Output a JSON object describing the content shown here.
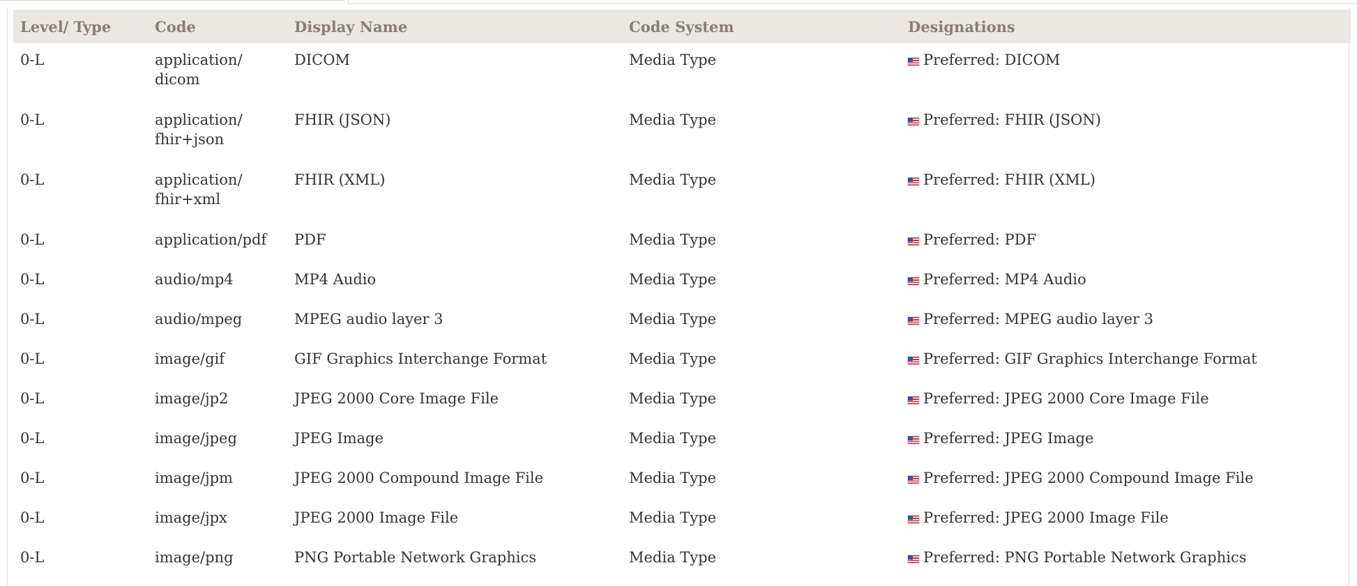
{
  "table": {
    "headers": [
      "Level/ Type",
      "Code",
      "Display Name",
      "Code System",
      "Designations"
    ],
    "rows": [
      {
        "level": "0-L",
        "code_line1": "application/",
        "code_line2": "dicom",
        "display": "DICOM",
        "system": "Media Type",
        "designation": "Preferred: DICOM"
      },
      {
        "level": "0-L",
        "code_line1": "application/",
        "code_line2": "fhir+json",
        "display": "FHIR (JSON)",
        "system": "Media Type",
        "designation": "Preferred: FHIR (JSON)"
      },
      {
        "level": "0-L",
        "code_line1": "application/",
        "code_line2": "fhir+xml",
        "display": "FHIR (XML)",
        "system": "Media Type",
        "designation": "Preferred: FHIR (XML)"
      },
      {
        "level": "0-L",
        "code_line1": "application/pdf",
        "code_line2": "",
        "display": "PDF",
        "system": "Media Type",
        "designation": "Preferred: PDF"
      },
      {
        "level": "0-L",
        "code_line1": "audio/mp4",
        "code_line2": "",
        "display": "MP4 Audio",
        "system": "Media Type",
        "designation": "Preferred: MP4 Audio"
      },
      {
        "level": "0-L",
        "code_line1": "audio/mpeg",
        "code_line2": "",
        "display": "MPEG audio layer 3",
        "system": "Media Type",
        "designation": "Preferred: MPEG audio layer 3"
      },
      {
        "level": "0-L",
        "code_line1": "image/gif",
        "code_line2": "",
        "display": "GIF Graphics Interchange Format",
        "system": "Media Type",
        "designation": "Preferred: GIF Graphics Interchange Format"
      },
      {
        "level": "0-L",
        "code_line1": "image/jp2",
        "code_line2": "",
        "display": "JPEG 2000 Core Image File",
        "system": "Media Type",
        "designation": "Preferred: JPEG 2000 Core Image File"
      },
      {
        "level": "0-L",
        "code_line1": "image/jpeg",
        "code_line2": "",
        "display": "JPEG Image",
        "system": "Media Type",
        "designation": "Preferred: JPEG Image"
      },
      {
        "level": "0-L",
        "code_line1": "image/jpm",
        "code_line2": "",
        "display": "JPEG 2000 Compound Image File",
        "system": "Media Type",
        "designation": "Preferred: JPEG 2000 Compound Image File"
      },
      {
        "level": "0-L",
        "code_line1": "image/jpx",
        "code_line2": "",
        "display": "JPEG 2000 Image File",
        "system": "Media Type",
        "designation": "Preferred: JPEG 2000 Image File"
      },
      {
        "level": "0-L",
        "code_line1": "image/png",
        "code_line2": "",
        "display": "PNG Portable Network Graphics",
        "system": "Media Type",
        "designation": "Preferred: PNG Portable Network Graphics"
      }
    ],
    "language_icon": "us-flag-icon"
  }
}
